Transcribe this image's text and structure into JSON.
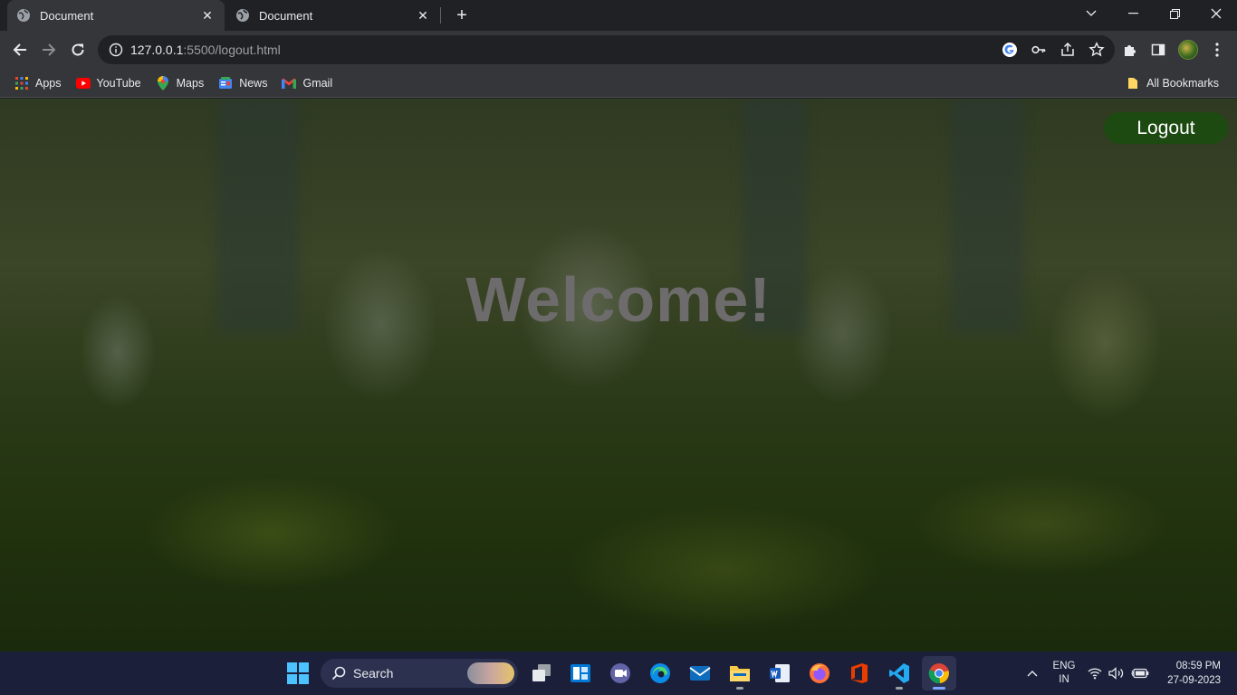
{
  "tabs": [
    {
      "title": "Document",
      "icon": "globe-icon",
      "active": true
    },
    {
      "title": "Document",
      "icon": "globe-icon",
      "active": false
    }
  ],
  "window_controls": [
    "chevron-down-icon",
    "minimize-icon",
    "restore-icon",
    "close-icon"
  ],
  "address_bar": {
    "host": "127.0.0.1",
    "path": ":5500/logout.html"
  },
  "bookmarks": [
    {
      "label": "Apps",
      "icon": "apps-grid-icon"
    },
    {
      "label": "YouTube",
      "icon": "youtube-icon"
    },
    {
      "label": "Maps",
      "icon": "maps-pin-icon"
    },
    {
      "label": "News",
      "icon": "news-icon"
    },
    {
      "label": "Gmail",
      "icon": "gmail-icon"
    }
  ],
  "all_bookmarks_label": "All Bookmarks",
  "page": {
    "logout_label": "Logout",
    "welcome_text": "Welcome!"
  },
  "taskbar": {
    "search_label": "Search",
    "language": {
      "line1": "ENG",
      "line2": "IN"
    },
    "clock": {
      "time": "08:59 PM",
      "date": "27-09-2023"
    }
  },
  "colors": {
    "logout_button": "#1c4a10",
    "welcome_text": "#6d6b6b",
    "taskbar": "#1b1f3a"
  }
}
